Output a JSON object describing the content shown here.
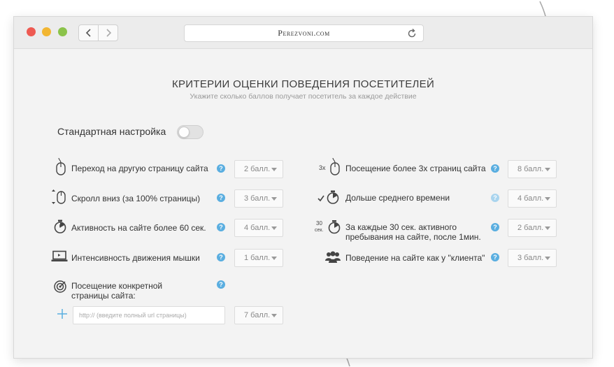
{
  "browser": {
    "address": "Perezvoni.com"
  },
  "header": {
    "title": "КРИТЕРИИ ОЦЕНКИ ПОВЕДЕНИЯ ПОСЕТИТЕЛЕЙ",
    "subtitle": "Укажите сколько баллов получает посетитель за каждое действие"
  },
  "standard": {
    "label": "Стандартная настройка",
    "enabled": false
  },
  "criteria_left": [
    {
      "icon": "mouse-icon",
      "label": "Переход на другую страницу сайта",
      "value": "2 балл."
    },
    {
      "icon": "scroll-mouse-icon",
      "label": "Скролл вниз (за 100% страницы)",
      "value": "3 балл."
    },
    {
      "icon": "stopwatch-icon",
      "label": "Активность на сайте более 60 сек.",
      "value": "4 балл."
    },
    {
      "icon": "laptop-icon",
      "label": "Интенсивность движения мышки",
      "value": "1 балл."
    }
  ],
  "criteria_right": [
    {
      "icon": "mouse-3x-icon",
      "icon_text": "3x",
      "label": "Посещение более 3х страниц сайта",
      "value": "8 балл."
    },
    {
      "icon": "check-stopwatch-icon",
      "label": "Дольше среднего времени",
      "value": "4 балл."
    },
    {
      "icon": "stopwatch-30-icon",
      "icon_text_top": "30",
      "icon_text_bottom": "сек.",
      "label_line1": "За каждые 30 сек. активного",
      "label_line2": "пребывания на сайте, после 1мин.",
      "value": "2 балл."
    },
    {
      "icon": "people-icon",
      "label": "Поведение на сайте как у \"клиента\"",
      "value": "3 балл."
    }
  ],
  "specific_page": {
    "label_line1": "Посещение конкретной",
    "label_line2": "страницы сайта:",
    "placeholder": "http:// (введите полный url страницы)",
    "value": "7 балл."
  },
  "help_symbol": "?"
}
